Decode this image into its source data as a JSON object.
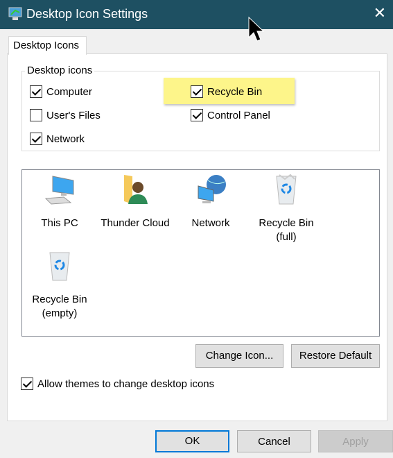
{
  "window": {
    "title": "Desktop Icon Settings",
    "icon": "display-settings-icon",
    "close": "close-icon"
  },
  "tab": {
    "label": "Desktop Icons"
  },
  "group": {
    "label": "Desktop icons",
    "checkboxes": [
      {
        "label": "Computer",
        "checked": true
      },
      {
        "label": "Recycle Bin",
        "checked": true,
        "highlighted": true
      },
      {
        "label": "User's Files",
        "checked": false
      },
      {
        "label": "Control Panel",
        "checked": true
      },
      {
        "label": "Network",
        "checked": true
      }
    ]
  },
  "icons": [
    {
      "label": "This PC",
      "icon": "computer-icon"
    },
    {
      "label": "Thunder Cloud",
      "icon": "user-folder-icon"
    },
    {
      "label": "Network",
      "icon": "network-icon"
    },
    {
      "label": "Recycle Bin\n(full)",
      "line1": "Recycle Bin",
      "line2": "(full)",
      "icon": "recycle-bin-full-icon"
    },
    {
      "label": "Recycle Bin\n(empty)",
      "line1": "Recycle Bin",
      "line2": "(empty)",
      "icon": "recycle-bin-empty-icon"
    }
  ],
  "buttons": {
    "change_icon": "Change Icon...",
    "restore_default": "Restore Default",
    "ok": "OK",
    "cancel": "Cancel",
    "apply": "Apply"
  },
  "allow_themes": {
    "label": "Allow themes to change desktop icons",
    "checked": true
  },
  "colors": {
    "titlebar": "#1e5062",
    "highlight": "#fdf58a",
    "focus": "#0078d7"
  }
}
